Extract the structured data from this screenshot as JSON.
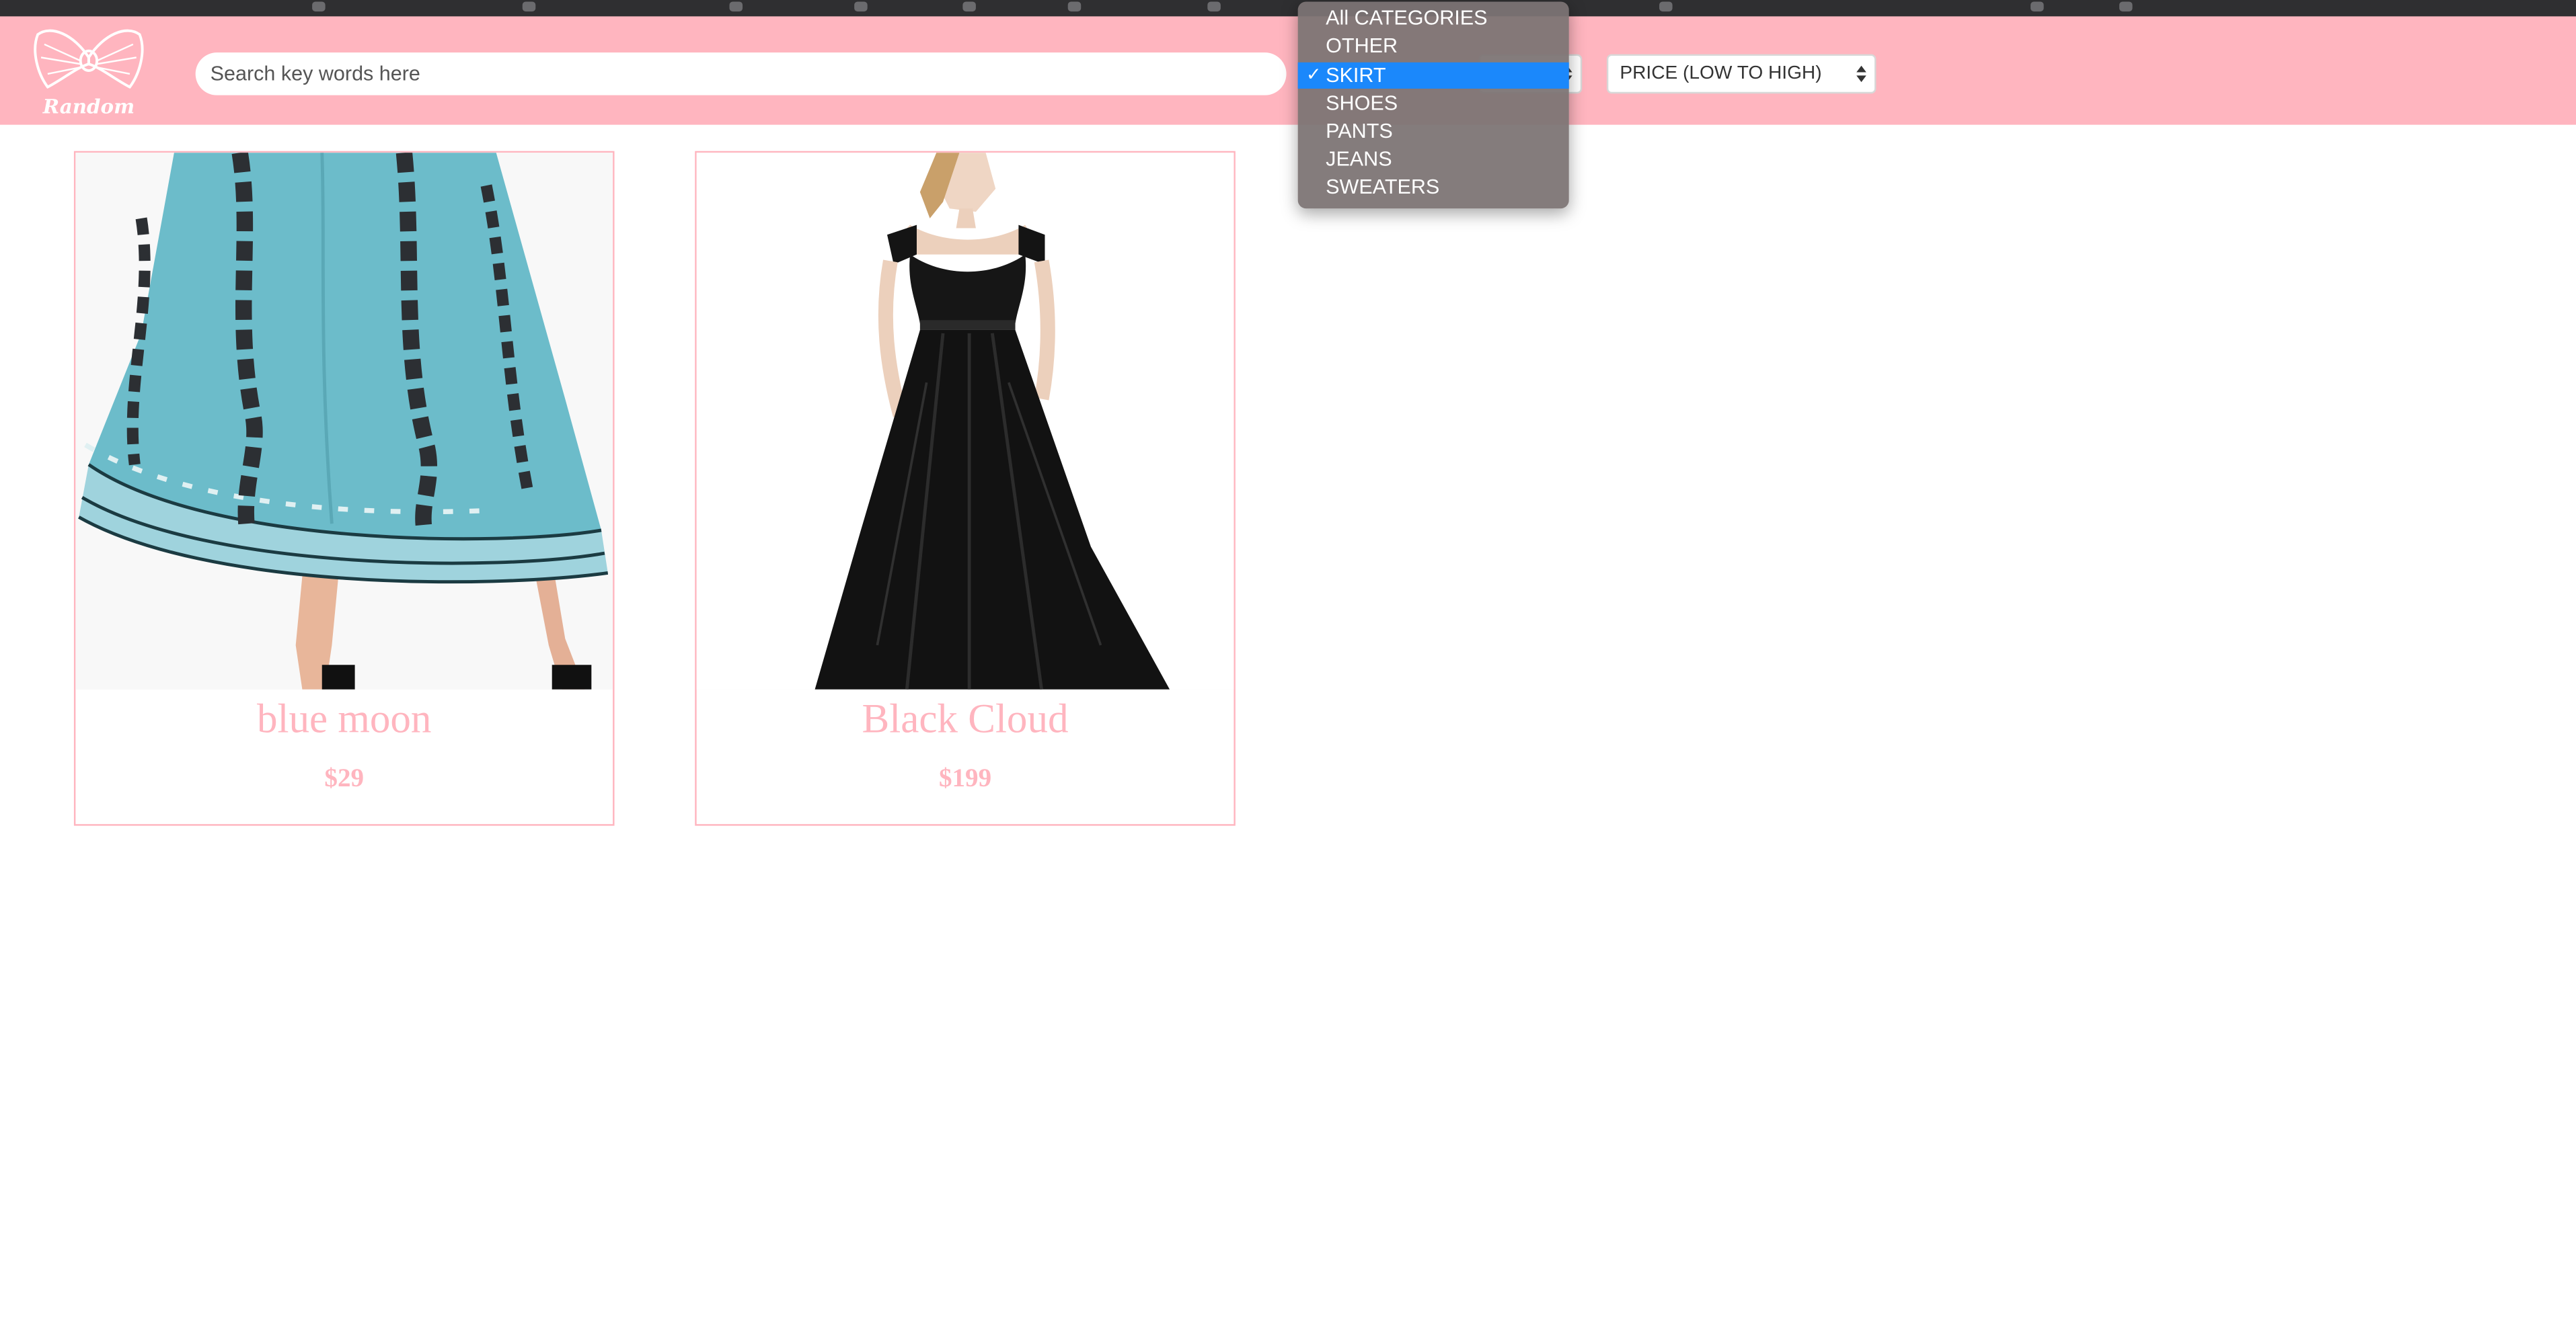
{
  "brand": {
    "name": "Random"
  },
  "search": {
    "placeholder": "Search key words here",
    "value": ""
  },
  "filters": {
    "category": {
      "selected": "SKIRT",
      "options": [
        {
          "label": "All CATEGORIES",
          "selected": false
        },
        {
          "label": "OTHER",
          "selected": false
        },
        {
          "label": "SKIRT",
          "selected": true
        },
        {
          "label": "SHOES",
          "selected": false
        },
        {
          "label": "PANTS",
          "selected": false
        },
        {
          "label": "JEANS",
          "selected": false
        },
        {
          "label": "SWEATERS",
          "selected": false
        }
      ],
      "check_glyph": "✓"
    },
    "sort": {
      "selected": "PRICE (LOW TO HIGH)"
    }
  },
  "products": [
    {
      "name": "blue moon",
      "price": "$29",
      "image_icon": "teal-paisley-skirt-photo"
    },
    {
      "name": "Black Cloud",
      "price": "$199",
      "image_icon": "black-gown-photo"
    }
  ],
  "colors": {
    "brand_pink": "#ffb5bf",
    "selection_blue": "#1b88fb",
    "menu_bg": "#7c7474"
  }
}
